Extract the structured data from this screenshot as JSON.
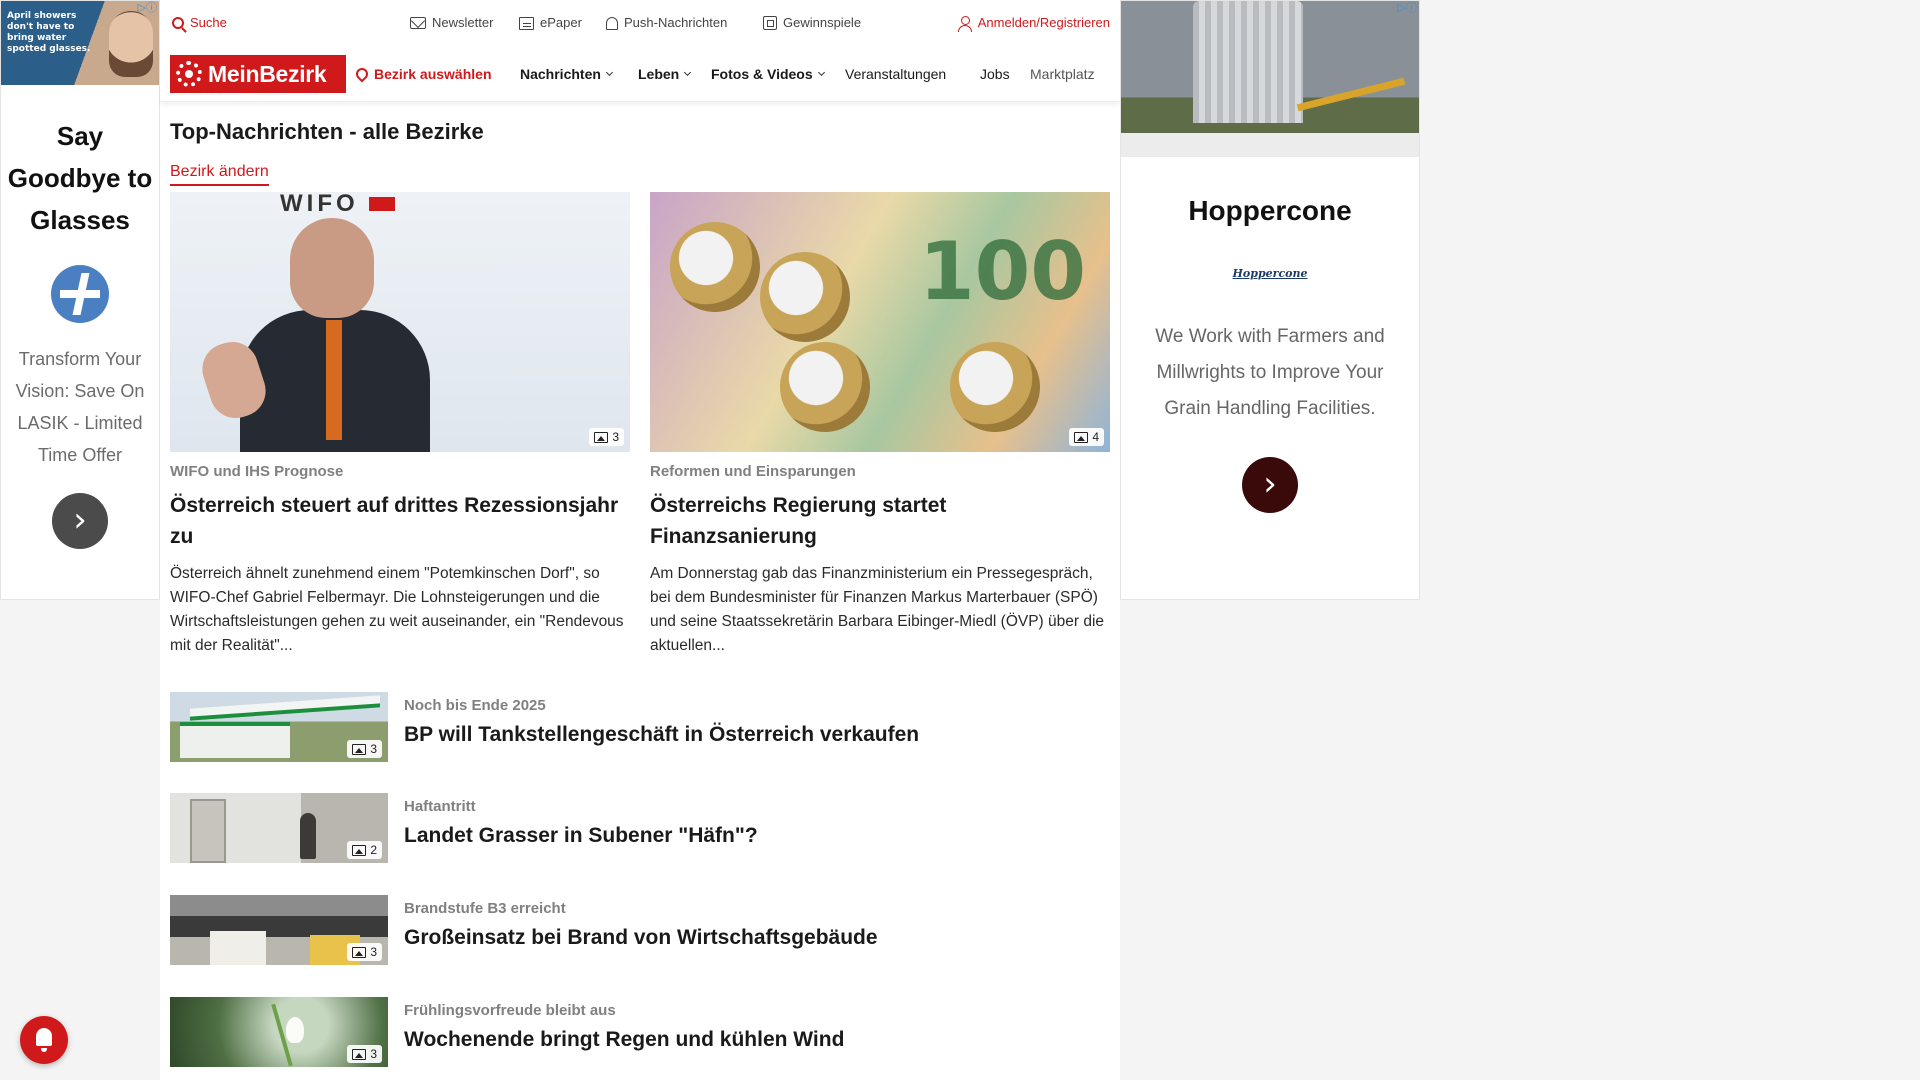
{
  "ad_left": {
    "thumb_text": "April showers don't have to bring water spotted glasses.",
    "headline": "Say Goodbye to Glasses",
    "description": "Transform Your Vision: Save On LASIK - Limited Time Offer",
    "arrow": "›",
    "adchoice": "▷ⓘ"
  },
  "ad_right": {
    "title": "Hoppercone",
    "logo_text": "Hoppercone",
    "description": "We Work with Farmers and Millwrights to Improve Your Grain Handling Facilities.",
    "arrow": "›",
    "adchoice": "▷ⓘ"
  },
  "topbar": {
    "search": "Suche",
    "newsletter": "Newsletter",
    "epaper": "ePaper",
    "push": "Push-Nachrichten",
    "gewinnspiele": "Gewinnspiele",
    "login": "Anmelden/Registrieren"
  },
  "nav": {
    "logo": "MeinBezirk",
    "bezirk": "Bezirk auswählen",
    "items": [
      "Nachrichten",
      "Leben",
      "Fotos & Videos",
      "Veranstaltungen",
      "Jobs",
      "Marktplatz"
    ]
  },
  "page": {
    "title": "Top-Nachrichten - alle Bezirke",
    "change_link": "Bezirk ändern"
  },
  "featured": [
    {
      "banner": "WIFO",
      "image_count": "3",
      "kicker": "WIFO und IHS Prognose",
      "headline": "Österreich steuert auf drittes Rezessionsjahr zu",
      "teaser": "Österreich ähnelt zunehmend einem \"Potemkinschen Dorf\", so WIFO-Chef Gabriel Felbermayr. Die Lohnsteigerungen und die Wirtschaftsleistungen gehen zu weit auseinander, ein \"Rendevous mit der Realität\"..."
    },
    {
      "banner": "100",
      "image_count": "4",
      "kicker": "Reformen und Einsparungen",
      "headline": "Österreichs Regierung startet Finanzsanierung",
      "teaser": "Am Donnerstag gab das Finanzministerium ein Pressegespräch, bei dem Bundesminister für Finanzen Markus Marterbauer (SPÖ) und seine Staatssekretärin Barbara Eibinger-Miedl (ÖVP) über die aktuellen..."
    }
  ],
  "list": [
    {
      "image_count": "3",
      "kicker": "Noch bis Ende 2025",
      "headline": "BP will Tankstellengeschäft in Österreich verkaufen"
    },
    {
      "image_count": "2",
      "kicker": "Haftantritt",
      "headline": "Landet Grasser in Subener \"Häfn\"?"
    },
    {
      "image_count": "3",
      "kicker": "Brandstufe B3 erreicht",
      "headline": "Großeinsatz bei Brand von Wirtschaftsgebäude"
    },
    {
      "image_count": "3",
      "kicker": "Frühlingsvorfreude bleibt aus",
      "headline": "Wochenende bringt Regen und kühlen Wind"
    }
  ],
  "colors": {
    "brand": "#d0191b",
    "text": "#1a1a1a",
    "kicker": "#808080"
  }
}
